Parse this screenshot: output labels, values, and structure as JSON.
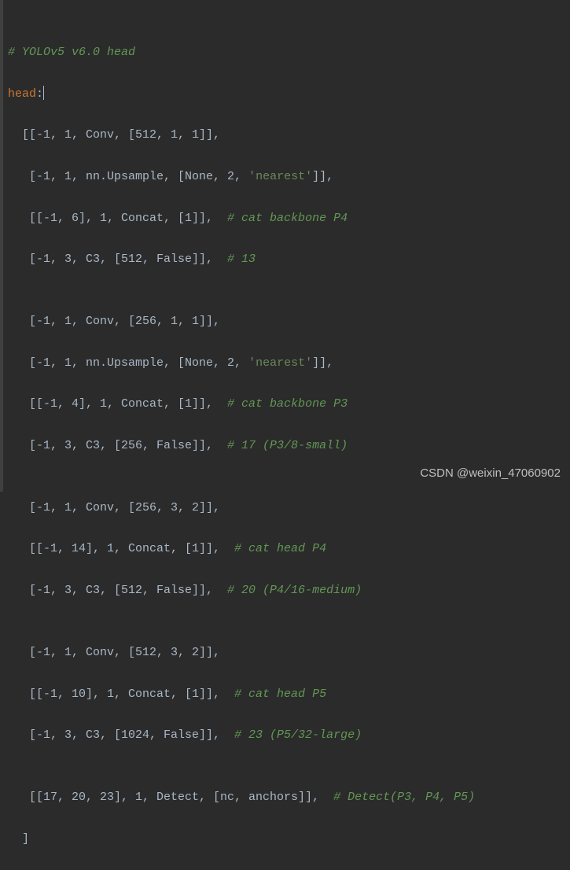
{
  "code": {
    "l01_comment": "# YOLOv5 v6.0 head",
    "l02_key": "head",
    "l02_colon": ":",
    "l03": "  [[-1, 1, Conv, [512, 1, 1]],",
    "l04_a": "   [-1, 1, nn.Upsample, [None, 2, ",
    "l04_s": "'nearest'",
    "l04_b": "]],",
    "l05_a": "   [[-1, 6], 1, Concat, [1]],  ",
    "l05_c": "# cat backbone P4",
    "l06_a": "   [-1, 3, C3, [512, False]],  ",
    "l06_c": "# 13",
    "l08": "   [-1, 1, Conv, [256, 1, 1]],",
    "l09_a": "   [-1, 1, nn.Upsample, [None, 2, ",
    "l09_s": "'nearest'",
    "l09_b": "]],",
    "l10_a": "   [[-1, 4], 1, Concat, [1]],  ",
    "l10_c": "# cat backbone P3",
    "l11_a": "   [-1, 3, C3, [256, False]],  ",
    "l11_c": "# 17 (P3/8-small)",
    "l13": "   [-1, 1, Conv, [256, 3, 2]],",
    "l14_a": "   [[-1, 14], 1, Concat, [1]],  ",
    "l14_c": "# cat head P4",
    "l15_a": "   [-1, 3, C3, [512, False]],  ",
    "l15_c": "# 20 (P4/16-medium)",
    "l17": "   [-1, 1, Conv, [512, 3, 2]],",
    "l18_a": "   [[-1, 10], 1, Concat, [1]],  ",
    "l18_c": "# cat head P5",
    "l19_a": "   [-1, 3, C3, [1024, False]],  ",
    "l19_c": "# 23 (P5/32-large)",
    "l21_a": "   [[17, 20, 23], 1, Detect, [nc, anchors]],  ",
    "l21_c": "# Detect(P3, P4, P5)",
    "l22": "  ]",
    "empty": ""
  },
  "watermark": "CSDN @weixin_47060902"
}
